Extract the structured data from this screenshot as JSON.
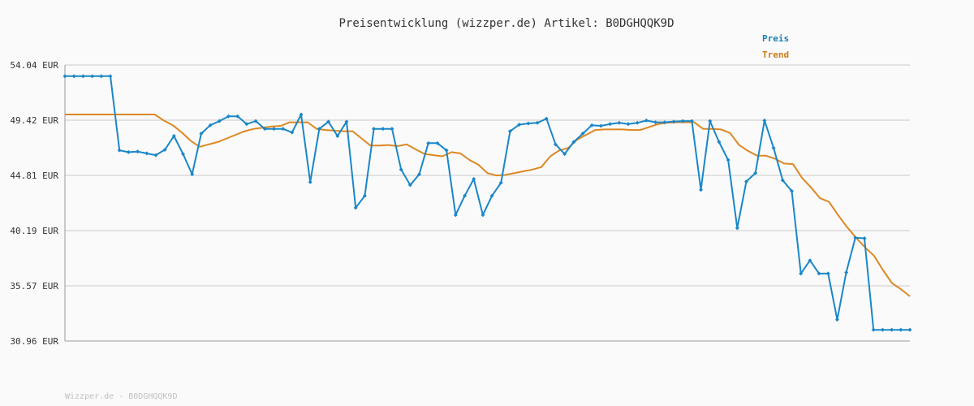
{
  "chart_data": {
    "type": "line",
    "title": "Preisentwicklung (wizzper.de) Artikel: B0DGHQQK9D",
    "ylim": [
      30.96,
      54.04
    ],
    "y_ticks": [
      "54.04 EUR",
      "49.42 EUR",
      "44.81 EUR",
      "40.19 EUR",
      "35.57 EUR",
      "30.96 EUR"
    ],
    "grid": true,
    "legend_position": "top-right",
    "series": [
      {
        "name": "Preis",
        "color": "#1a87c7",
        "markers": true,
        "values": [
          53.1,
          53.1,
          53.1,
          53.1,
          53.1,
          53.1,
          46.9,
          46.75,
          46.8,
          46.65,
          46.5,
          46.95,
          48.1,
          46.6,
          44.9,
          48.3,
          49.0,
          49.35,
          49.75,
          49.75,
          49.1,
          49.35,
          48.7,
          48.7,
          48.7,
          48.4,
          49.9,
          44.25,
          48.7,
          49.3,
          48.1,
          49.3,
          42.1,
          43.1,
          48.7,
          48.7,
          48.7,
          45.3,
          44.0,
          44.9,
          47.5,
          47.5,
          46.9,
          41.5,
          43.1,
          44.5,
          41.5,
          43.1,
          44.2,
          48.5,
          49.05,
          49.15,
          49.2,
          49.55,
          47.4,
          46.6,
          47.6,
          48.3,
          49.0,
          48.95,
          49.1,
          49.2,
          49.1,
          49.2,
          49.4,
          49.25,
          49.25,
          49.3,
          49.35,
          49.35,
          43.6,
          49.35,
          47.6,
          46.1,
          40.4,
          44.3,
          45.0,
          49.4,
          47.1,
          44.4,
          43.5,
          36.6,
          37.7,
          36.6,
          36.6,
          32.75,
          36.7,
          39.6,
          39.55,
          31.9,
          31.9,
          31.9,
          31.9,
          31.9
        ]
      },
      {
        "name": "Trend",
        "color": "#dd8822",
        "markers": false,
        "values": [
          49.9,
          49.9,
          49.9,
          49.9,
          49.9,
          49.9,
          49.9,
          49.9,
          49.9,
          49.9,
          49.9,
          49.4,
          49.0,
          48.4,
          47.7,
          47.2,
          47.4,
          47.6,
          47.9,
          48.2,
          48.5,
          48.7,
          48.8,
          48.9,
          48.95,
          49.25,
          49.25,
          49.25,
          48.7,
          48.6,
          48.55,
          48.5,
          48.5,
          47.9,
          47.3,
          47.3,
          47.35,
          47.25,
          47.4,
          47.0,
          46.6,
          46.5,
          46.4,
          46.75,
          46.65,
          46.1,
          45.7,
          45.0,
          44.8,
          44.85,
          45.0,
          45.15,
          45.3,
          45.5,
          46.4,
          46.9,
          47.1,
          47.8,
          48.2,
          48.6,
          48.65,
          48.65,
          48.65,
          48.6,
          48.6,
          48.85,
          49.1,
          49.2,
          49.25,
          49.25,
          49.25,
          48.7,
          48.7,
          48.65,
          48.35,
          47.35,
          46.85,
          46.45,
          46.45,
          46.2,
          45.8,
          45.75,
          44.6,
          43.8,
          42.9,
          42.6,
          41.5,
          40.5,
          39.6,
          38.8,
          38.1,
          36.9,
          35.8,
          35.3,
          34.7
        ]
      }
    ]
  },
  "footer": "Wizzper.de - B0DGHQQK9D"
}
